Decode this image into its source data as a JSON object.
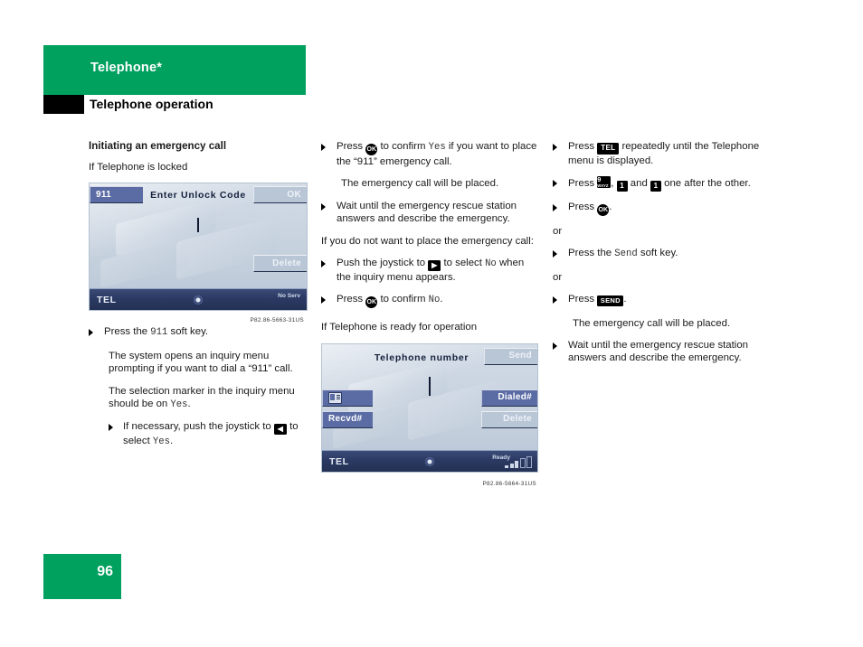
{
  "header": {
    "chapter": "Telephone*",
    "section": "Telephone operation"
  },
  "page_number": "96",
  "col1": {
    "heading": "Initiating an emergency call",
    "lead": "If Telephone is locked",
    "screen": {
      "softkey_911": "911",
      "title": "Enter Unlock Code",
      "softkey_ok": "OK",
      "softkey_delete": "Delete",
      "status_tel": "TEL",
      "status_service": "No Serv"
    },
    "caption": "P82.86-5663-31US",
    "steps": [
      {
        "pre": "Press the ",
        "code": "911",
        "post": " soft key."
      }
    ],
    "para1": "The system opens an inquiry menu prompting if you want to dial a “911” call.",
    "para2_pre": "The selection marker in the inquiry menu should be on ",
    "para2_code": "Yes",
    "para2_post": ".",
    "substep": {
      "text_pre": "If necessary, push the joystick to ",
      "key": "◀",
      "text_mid": " to select ",
      "code": "Yes",
      "text_post": "."
    }
  },
  "col2": {
    "step1_pre": "Press ",
    "step1_key": "OK",
    "step1_mid": " to confirm ",
    "step1_code": "Yes",
    "step1_post": " if you want to place the “911” emergency call.",
    "note1": "The emergency call will be placed.",
    "step2": "Wait until the emergency rescue station answers and describe the emergency.",
    "lead2": "If you do not want to place the emergency call:",
    "step3_pre": "Push the joystick to ",
    "step3_key": "▶",
    "step3_mid": " to select ",
    "step3_code": "No",
    "step3_post": " when the inquiry menu appears.",
    "step4_pre": "Press ",
    "step4_key": "OK",
    "step4_mid": " to confirm ",
    "step4_code": "No",
    "step4_post": ".",
    "lead3": "If Telephone is ready for operation",
    "screen": {
      "title": "Telephone number",
      "softkey_send": "Send",
      "softkey_dialed": "Dialed#",
      "softkey_delete": "Delete",
      "softkey_recvd": "Recvd#",
      "phonebook_icon": "phonebook-icon",
      "status_tel": "TEL",
      "status_ready": "Ready"
    },
    "caption": "P82.86-5664-31US"
  },
  "col3": {
    "step1_pre": "Press ",
    "step1_key": "TEL",
    "step1_post": " repeatedly until the Telephone menu is displayed.",
    "step2_pre": "Press ",
    "step2_key9": "9",
    "step2_key9sub": "WXYZ",
    "step2_comma": ", ",
    "step2_key1a": "1",
    "step2_and": " and ",
    "step2_key1b": "1",
    "step2_post": " one after the other.",
    "step3_pre": "Press ",
    "step3_key": "OK",
    "step3_post": ".",
    "or1": "or",
    "step4_pre": "Press the ",
    "step4_code": "Send",
    "step4_post": " soft key.",
    "or2": "or",
    "step5_pre": "Press ",
    "step5_key": "SEND",
    "step5_post": ".",
    "note1": "The emergency call will be placed.",
    "step6": "Wait until the emergency rescue station answers and describe the emergency."
  },
  "colors": {
    "brand_green": "#00a05f",
    "lcd_bg": "#c9d4e0",
    "lcd_accent": "#5b6ca4",
    "lcd_statusbar": "#2b3a63"
  }
}
